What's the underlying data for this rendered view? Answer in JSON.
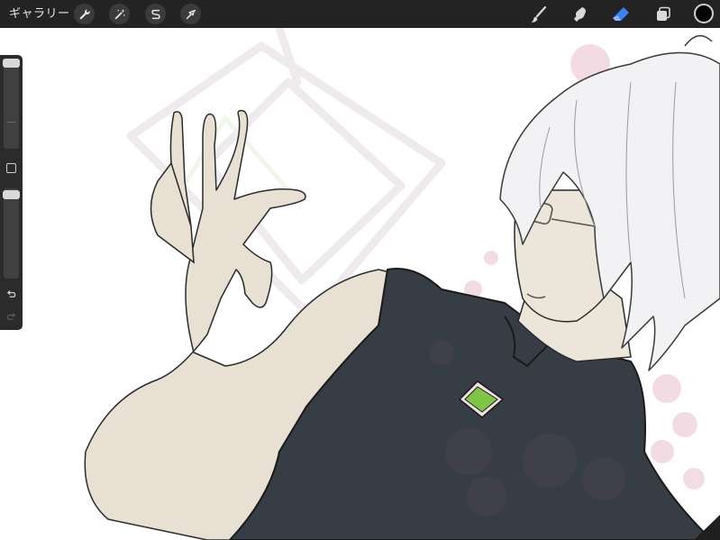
{
  "toolbar": {
    "gallery_label": "ギャラリー",
    "left_tools": [
      {
        "name": "actions",
        "icon": "wrench-icon"
      },
      {
        "name": "adjustments",
        "icon": "magic-wand-icon"
      },
      {
        "name": "selection",
        "icon": "selection-s-icon"
      },
      {
        "name": "transform",
        "icon": "arrow-cursor-icon"
      }
    ],
    "right_tools": [
      {
        "name": "brush",
        "icon": "brush-icon",
        "active": false
      },
      {
        "name": "smudge",
        "icon": "smudge-icon",
        "active": false
      },
      {
        "name": "eraser",
        "icon": "eraser-icon",
        "active": true
      },
      {
        "name": "layers",
        "icon": "layers-icon",
        "active": false
      }
    ],
    "current_color": "#050505"
  },
  "colors": {
    "toolbar_bg": "#232323",
    "active_tool": "#3a82f7",
    "inactive_tool": "#d9d9d9",
    "sidebar_bg": "#2b2b2b"
  },
  "sidebar": {
    "brush_size_level": 0.08,
    "opacity_level": 0.08
  }
}
